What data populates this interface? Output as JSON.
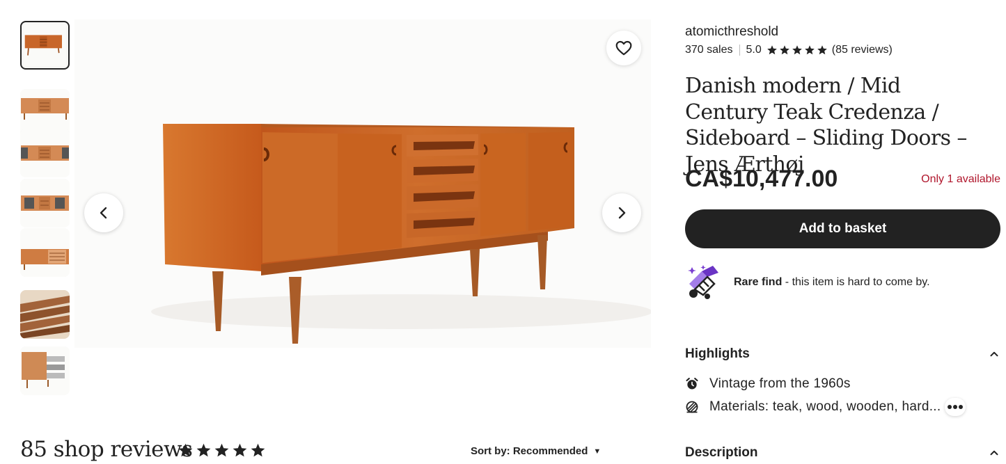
{
  "gallery": {
    "thumbnails": [
      {
        "name": "thumbnail-1",
        "active": true
      },
      {
        "name": "thumbnail-2",
        "active": false
      },
      {
        "name": "thumbnail-3",
        "active": false
      },
      {
        "name": "thumbnail-4",
        "active": false
      },
      {
        "name": "thumbnail-5",
        "active": false
      },
      {
        "name": "thumbnail-6",
        "active": false
      },
      {
        "name": "thumbnail-7",
        "active": false
      }
    ],
    "prev_icon": "chevron-left-icon",
    "next_icon": "chevron-right-icon",
    "favorite_icon": "heart-icon"
  },
  "shop": {
    "name": "atomicthreshold",
    "sales": "370 sales",
    "rating": "5.0",
    "rating_stars": 5,
    "reviews": "(85 reviews)"
  },
  "listing": {
    "title": "Danish modern / Mid Century Teak Credenza / Sideboard – Sliding Doors – Jens Ærthøj",
    "price": "CA$10,477.00",
    "stock": "Only 1 available",
    "add_to_basket": "Add to basket",
    "rare_find_bold": "Rare find",
    "rare_find_text": " - this item is hard to come by."
  },
  "highlights": {
    "heading": "Highlights",
    "items": [
      {
        "icon": "alarm-clock-icon",
        "text": "Vintage from the 1960s"
      },
      {
        "icon": "materials-icon",
        "text": "Materials: teak, wood, wooden, hard..."
      }
    ],
    "more_icon": "more-dots-icon"
  },
  "description": {
    "heading": "Description"
  },
  "reviews": {
    "title": "85 shop reviews",
    "stars": 5,
    "sort_label": "Sort by: Recommended"
  },
  "colors": {
    "text": "#222222",
    "stock_red": "#b0162c",
    "button_dark": "#222222",
    "teak": "#c8662a"
  }
}
